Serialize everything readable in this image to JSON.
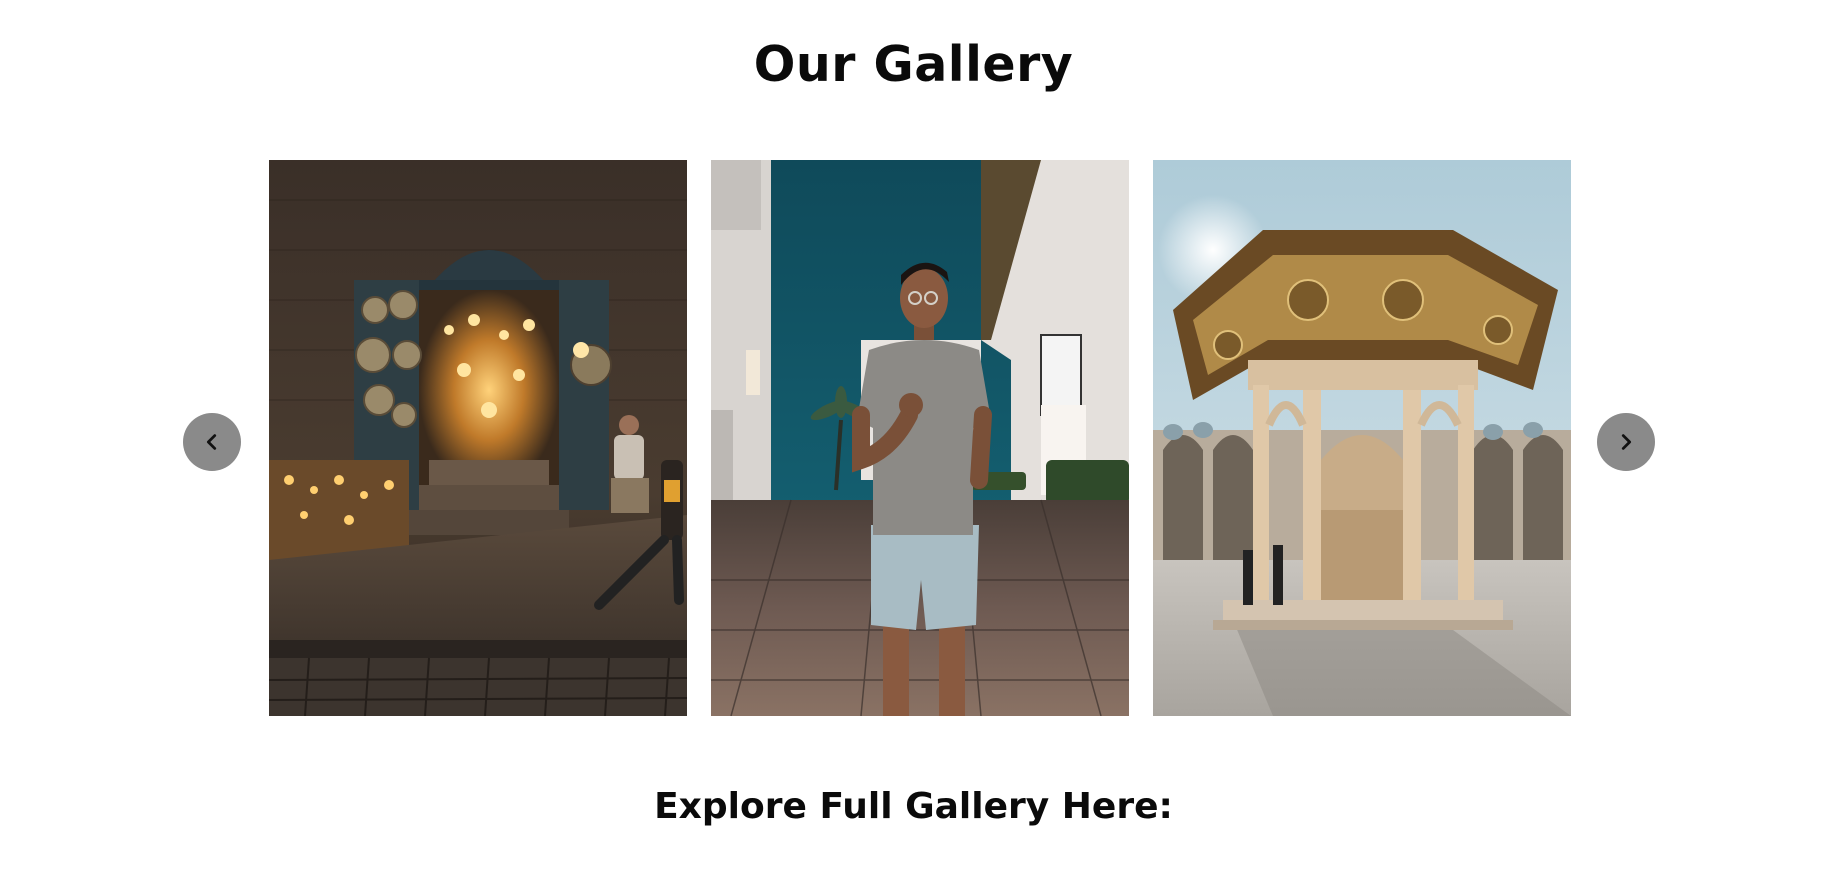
{
  "gallery": {
    "title": "Our Gallery",
    "explore_label": "Explore Full Gallery Here:"
  },
  "carousel": {
    "prev_icon": "chevron-left-icon",
    "next_icon": "chevron-right-icon",
    "slides": [
      {
        "name": "bazaar-lantern-shop-photo"
      },
      {
        "name": "man-posing-at-night-photo"
      },
      {
        "name": "mosque-ablution-fountain-photo"
      }
    ]
  },
  "colors": {
    "nav_button_bg": "#8a8a8a",
    "text": "#0a0a0a",
    "background": "#ffffff"
  }
}
